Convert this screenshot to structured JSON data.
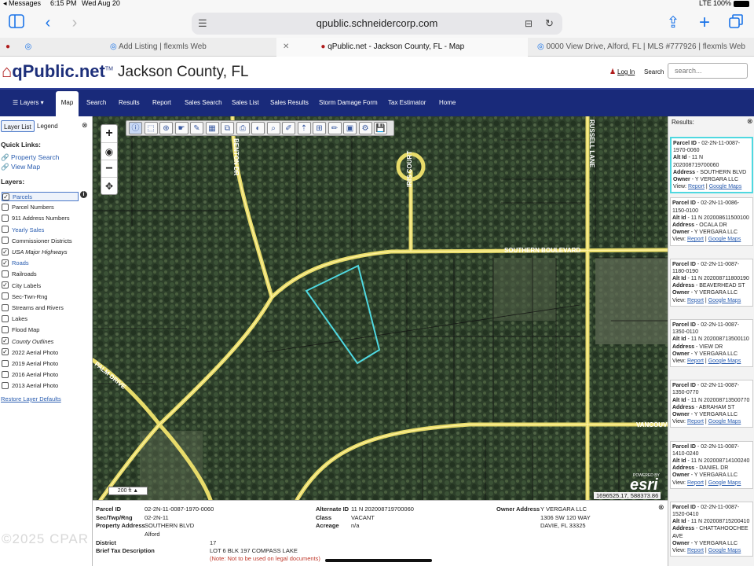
{
  "status": {
    "carrier": "◂ Messages",
    "time": "6:15 PM",
    "date": "Wed Aug 20",
    "network": "LTE",
    "battery": "100%"
  },
  "browser": {
    "url": "qpublic.schneidercorp.com",
    "tabs": [
      {
        "label": "Add Listing | flexmls Web"
      },
      {
        "label": "qPublic.net - Jackson County, FL - Map"
      },
      {
        "label": "0000 View Drive, Alford, FL | MLS #777926 | flexmls Web"
      }
    ]
  },
  "site": {
    "logo": "qPublic.net",
    "logo_tm": "TM",
    "county": "Jackson County, FL",
    "login": "Log In",
    "search_label": "Search",
    "search_placeholder": "search..."
  },
  "nav": [
    "Layers",
    "Map",
    "Search",
    "Results",
    "Report",
    "Sales Search",
    "Sales List",
    "Sales Results",
    "Storm Damage Form",
    "Tax Estimator",
    "Home"
  ],
  "left": {
    "tabs": [
      "Layer List",
      "Legend"
    ],
    "quick_links_title": "Quick Links:",
    "quick_links": [
      "Property Search",
      "View Map"
    ],
    "layers_title": "Layers:",
    "layers": [
      {
        "label": "Parcels",
        "checked": true
      },
      {
        "label": "Parcel Numbers",
        "checked": false
      },
      {
        "label": "911 Address Numbers",
        "checked": false
      },
      {
        "label": "Yearly Sales",
        "checked": false
      },
      {
        "label": "Commissioner Districts",
        "checked": false
      },
      {
        "label": "USA Major Highways",
        "checked": true
      },
      {
        "label": "Roads",
        "checked": true
      },
      {
        "label": "Railroads",
        "checked": false
      },
      {
        "label": "City Labels",
        "checked": true
      },
      {
        "label": "Sec-Twn-Rng",
        "checked": false
      },
      {
        "label": "Streams and Rivers",
        "checked": false
      },
      {
        "label": "Lakes",
        "checked": false
      },
      {
        "label": "Flood Map",
        "checked": false
      },
      {
        "label": "County Outlines",
        "checked": true
      },
      {
        "label": "2022 Aerial Photo",
        "checked": true
      },
      {
        "label": "2019 Aerial Photo",
        "checked": false
      },
      {
        "label": "2016 Aerial Photo",
        "checked": false
      },
      {
        "label": "2013 Aerial Photo",
        "checked": false
      }
    ],
    "restore": "Restore Layer Defaults"
  },
  "map": {
    "road_labels": [
      "BENTON DR",
      "IRIS COURT",
      "RUSSELL LANE",
      "SOUTHERN BOULEVARD",
      "VANCOUVER",
      "PALM DRIVE"
    ],
    "scale": "200 ft",
    "coords": "1696525.17, 588373.86",
    "esri_powered": "POWERED BY",
    "esri": "esri",
    "watermark": "©2025 CPAR",
    "parcel_color": "#4fd8e0"
  },
  "results": {
    "title": "Results:",
    "view_label": "View:",
    "report_label": "Report",
    "google_label": "Google Maps",
    "items": [
      {
        "parcel": "02-2N-11-0087-1970-0060",
        "alt": "11 N 202008719700060",
        "address": "SOUTHERN BLVD",
        "owner": "Y VERGARA LLC"
      },
      {
        "parcel": "02-2N-11-0086-1150-0100",
        "alt": "11 N 202008611500100",
        "address": "OCALA DR",
        "owner": "Y VERGARA LLC"
      },
      {
        "parcel": "02-2N-11-0087-1180-0190",
        "alt": "11 N 202008711800190",
        "address": "BEAVERHEAD ST",
        "owner": "Y VERGARA LLC"
      },
      {
        "parcel": "02-2N-11-0087-1350-0110",
        "alt": "11 N 202008713500110",
        "address": "VIEW DR",
        "owner": "Y VERGARA LLC"
      },
      {
        "parcel": "02-2N-11-0087-1350-0770",
        "alt": "11 N 202008713500770",
        "address": "ABRAHAM ST",
        "owner": "Y VERGARA LLC"
      },
      {
        "parcel": "02-2N-11-0087-1410-0240",
        "alt": "11 N 202008714100240",
        "address": "DANIEL DR",
        "owner": "Y VERGARA LLC"
      },
      {
        "parcel": "02-2N-11-0087-1520-0410",
        "alt": "11 N 202008715200410",
        "address": "CHATTAHOOCHEE AVE",
        "owner": "Y VERGARA LLC"
      }
    ]
  },
  "info": {
    "parcel_id_label": "Parcel ID",
    "parcel_id": "02-2N-11-0087-1970-0060",
    "str_label": "Sec/Twp/Rng",
    "str": "02-2N-11",
    "addr_label": "Property Address",
    "addr": "SOUTHERN BLVD",
    "city": "Alford",
    "district_label": "District",
    "district": "17",
    "desc_label": "Brief Tax Description",
    "desc": "LOT 6 BLK 197 COMPASS LAKE",
    "note": "(Note: Not to be used on legal documents)",
    "alt_label": "Alternate ID",
    "alt": "11 N 202008719700060",
    "class_label": "Class",
    "class": "VACANT",
    "acreage_label": "Acreage",
    "acreage": "n/a",
    "owner_label": "Owner Address",
    "owner": "Y VERGARA LLC",
    "owner2": "1306 SW 120 WAY",
    "owner3": "DAVIE, FL 33325"
  }
}
